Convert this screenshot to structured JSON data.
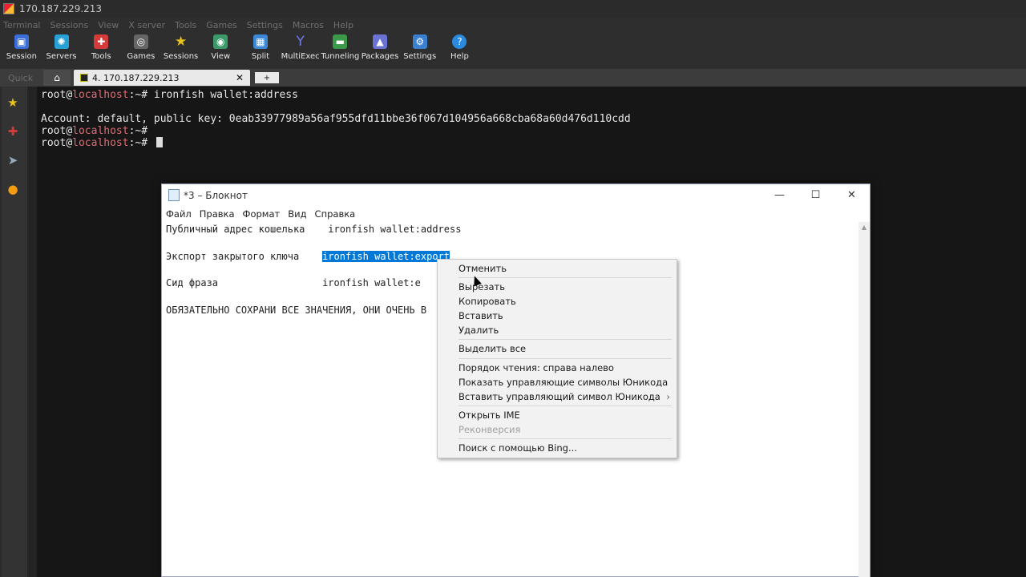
{
  "moba": {
    "title": "170.187.229.213",
    "menu": [
      "Terminal",
      "Sessions",
      "View",
      "X server",
      "Tools",
      "Games",
      "Settings",
      "Macros",
      "Help"
    ],
    "toolbar": [
      {
        "label": "Session",
        "icon": "session-icon",
        "color": "#3b6fd8"
      },
      {
        "label": "Servers",
        "icon": "servers-icon",
        "color": "#27a0d6"
      },
      {
        "label": "Tools",
        "icon": "tools-icon",
        "color": "#d33b3b"
      },
      {
        "label": "Games",
        "icon": "games-icon",
        "color": "#666666"
      },
      {
        "label": "Sessions",
        "icon": "star-icon",
        "color": "#e8c21c"
      },
      {
        "label": "View",
        "icon": "view-icon",
        "color": "#3c9a6a"
      },
      {
        "label": "Split",
        "icon": "split-icon",
        "color": "#3d88d6"
      },
      {
        "label": "MultiExec",
        "icon": "multiexec-icon",
        "color": "#4a5bd0"
      },
      {
        "label": "Tunneling",
        "icon": "tunneling-icon",
        "color": "#3a9a4a"
      },
      {
        "label": "Packages",
        "icon": "packages-icon",
        "color": "#6a72d4"
      },
      {
        "label": "Settings",
        "icon": "settings-icon",
        "color": "#3b7fd0"
      },
      {
        "label": "Help",
        "icon": "help-icon",
        "color": "#2a8ae0"
      }
    ],
    "quick_label": "Quick",
    "session_tab": "4. 170.187.229.213",
    "new_tab": "+"
  },
  "terminal": {
    "lines": [
      {
        "user": "root",
        "at": "@",
        "host": "localhost",
        "path": ":~# ",
        "cmd": "ironfish wallet:address"
      },
      {
        "text": ""
      },
      {
        "text": "Account: default, public key: 0eab33977989a56af955dfd11bbe36f067d104956a668cba68a60d476d110cdd"
      },
      {
        "user": "root",
        "at": "@",
        "host": "localhost",
        "path": ":~# ",
        "cmd": ""
      },
      {
        "user": "root",
        "at": "@",
        "host": "localhost",
        "path": ":~# ",
        "cmd": ""
      }
    ]
  },
  "notepad": {
    "title": "*3 – Блокнот",
    "menu": [
      "Файл",
      "Правка",
      "Формат",
      "Вид",
      "Справка"
    ],
    "line1": "Публичный адрес кошелька    ironfish wallet:address",
    "line3_prefix": "Экспорт закрытого ключа    ",
    "line3_selected": "ironfish wallet:export",
    "line5": "Сид фраза                  ironfish wallet:e",
    "line7": "ОБЯЗАТЕЛЬНО СОХРАНИ ВСЕ ЗНАЧЕНИЯ, ОНИ ОЧЕНЬ В"
  },
  "context_menu": {
    "undo": "Отменить",
    "cut": "Вырезать",
    "copy": "Копировать",
    "paste": "Вставить",
    "delete": "Удалить",
    "select_all": "Выделить все",
    "rtl": "Порядок чтения: справа налево",
    "show_unicode": "Показать управляющие символы Юникода",
    "insert_unicode": "Вставить управляющий символ Юникода",
    "open_ime": "Открыть IME",
    "reconversion": "Реконверсия",
    "bing": "Поиск с помощью Bing..."
  }
}
